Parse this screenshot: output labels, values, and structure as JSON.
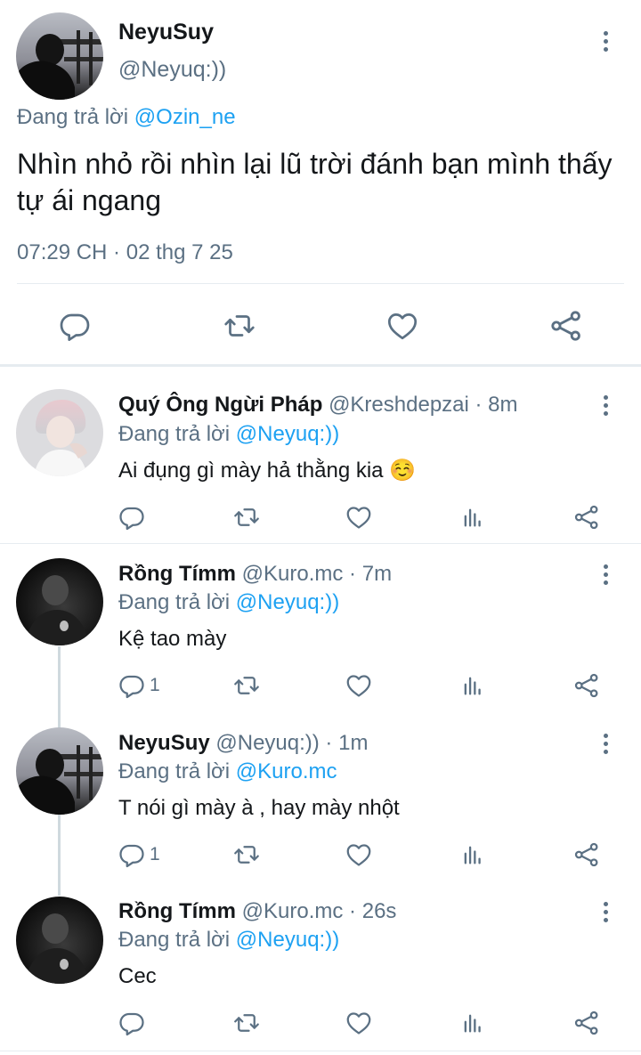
{
  "main_tweet": {
    "display_name": "NeyuSuy",
    "handle": "@Neyuq:))",
    "replying_prefix": "Đang trả lời",
    "replying_to": "@Ozin_ne",
    "text_line1": "Nhìn nhỏ rồi nhìn lại lũ trời đánh bạn mình thấy",
    "text_line2": "tự ái ngang",
    "timestamp": "07:29 CH · 02 thg 7 25"
  },
  "replies": [
    {
      "display_name": "Quý Ông Ngừi Pháp",
      "meta": "@Kreshdepzai · 8m",
      "replying_prefix": "Đang trả lời",
      "replying_to": "@Neyuq:))",
      "text": "Ai đụng gì mày hả thằng kia ☺️",
      "reply_count": ""
    },
    {
      "display_name": "Rồng Tímm",
      "meta": "@Kuro.mc · 7m",
      "replying_prefix": "Đang trả lời",
      "replying_to": "@Neyuq:))",
      "text": "Kệ tao mày",
      "reply_count": "1"
    },
    {
      "display_name": "NeyuSuy",
      "meta": "@Neyuq:)) · 1m",
      "replying_prefix": "Đang trả lời",
      "replying_to": "@Kuro.mc",
      "text": "T nói gì mày à , hay mày nhột",
      "reply_count": "1"
    },
    {
      "display_name": "Rồng Tímm",
      "meta": "@Kuro.mc · 26s",
      "replying_prefix": "Đang trả lời",
      "replying_to": "@Neyuq:))",
      "text": "Cec",
      "reply_count": ""
    }
  ],
  "icons": {
    "reply": "reply-icon",
    "retweet": "retweet-icon",
    "like": "like-icon",
    "analytics": "analytics-icon",
    "share": "share-icon",
    "more": "more-icon"
  },
  "colors": {
    "link": "#1da1f2",
    "muted": "#5b7083",
    "divider": "#e6ecf0"
  }
}
